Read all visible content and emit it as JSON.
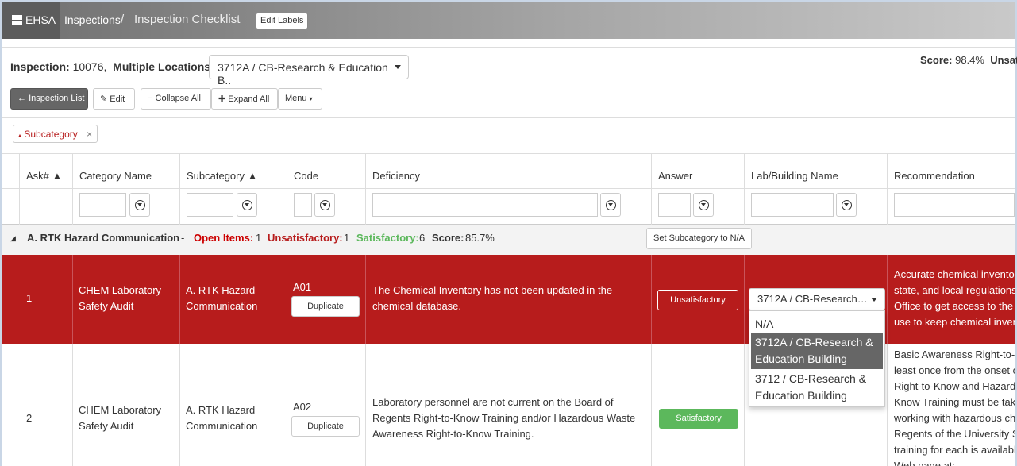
{
  "header": {
    "brand": "EHSA",
    "crumb_inspections": "Inspections",
    "crumb_sep": "/",
    "crumb_current": "Inspection Checklist",
    "edit_labels": "Edit Labels"
  },
  "info": {
    "inspection_label": "Inspection:",
    "inspection_value": "10076,",
    "locations_label": "Multiple Locations:",
    "location_selected": "3712A / CB-Research & Education B..",
    "score_label": "Score:",
    "score_value": "98.4%",
    "unsat_label": "Unsat"
  },
  "toolbar": {
    "inspection_list": "Inspection List",
    "edit": "Edit",
    "collapse_all": "Collapse All",
    "expand_all": "Expand All",
    "menu": "Menu"
  },
  "group_chip": {
    "label": "Subcategory",
    "remove": "×"
  },
  "columns": {
    "ask": "Ask# ▲",
    "category": "Category Name",
    "subcategory": "Subcategory ▲",
    "code": "Code",
    "deficiency": "Deficiency",
    "answer": "Answer",
    "lab": "Lab/Building Name",
    "recommendation": "Recommendation"
  },
  "group": {
    "title": "A. RTK Hazard Communication",
    "dash": "-",
    "open_label": "Open Items:",
    "open_value": "1",
    "unsat_label": "Unsatisfactory:",
    "unsat_value": "1",
    "sat_label": "Satisfactory:",
    "sat_value": "6",
    "score_label": "Score:",
    "score_value": "85.7%",
    "set_na": "Set Subcategory to N/A"
  },
  "rows": [
    {
      "ask": "1",
      "category": "CHEM Laboratory Safety Audit",
      "subcategory": "A. RTK Hazard Communication",
      "code": "A01",
      "duplicate": "Duplicate",
      "deficiency": "The Chemical Inventory has not been updated in the chemical database.",
      "answer": "Unsatisfactory",
      "lab_selected": "3712A / CB-Research…",
      "recommendation": [
        "Accurate chemical inventor",
        "state, and local regulations",
        "Office to get access to the",
        "use to keep chemical inven"
      ]
    },
    {
      "ask": "2",
      "category": "CHEM Laboratory Safety Audit",
      "subcategory": "A. RTK Hazard Communication",
      "code": "A02",
      "duplicate": "Duplicate",
      "deficiency": "Laboratory personnel are not current on the Board of Regents Right-to-Know Training and/or Hazardous Waste Awareness Right-to-Know Training.",
      "answer": "Satisfactory",
      "recommendation": [
        "Basic Awareness Right-to-K",
        "least once from the onset o",
        "Right-to-Know  and Hazard",
        "Know Training must be take",
        "working with hazardous che",
        "Regents of the University S",
        "training for each is availabl",
        "Web page at:"
      ]
    }
  ],
  "lab_dropdown": {
    "options": [
      "N/A",
      "3712A / CB-Research & Education Building",
      "3712 / CB-Research & Education Building"
    ]
  },
  "colors": {
    "danger": "#b71c1c",
    "success": "#5cb85c",
    "dark": "#666666"
  }
}
